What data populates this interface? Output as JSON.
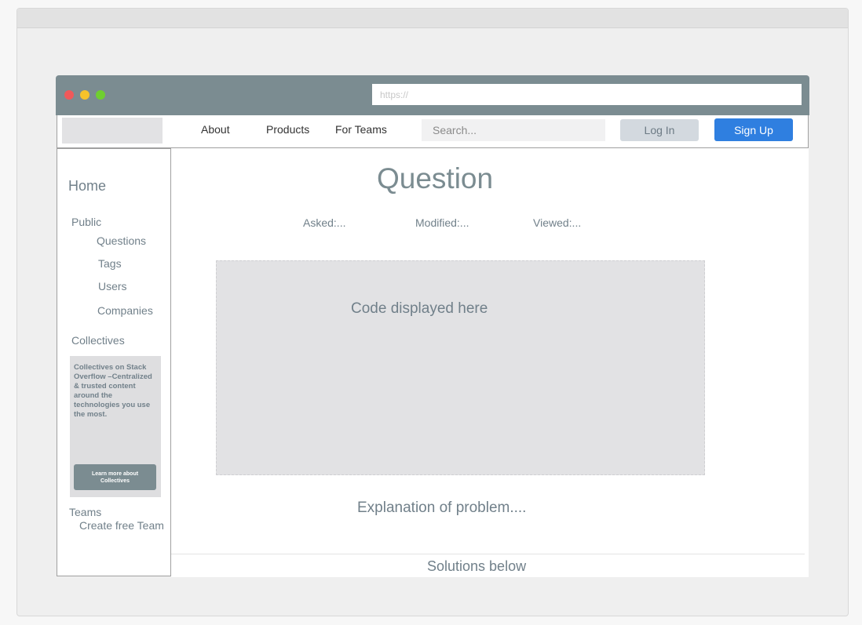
{
  "browser": {
    "url_placeholder": "https://"
  },
  "nav": {
    "links": [
      "About",
      "Products",
      "For Teams"
    ],
    "search_placeholder": "Search...",
    "login_label": "Log In",
    "signup_label": "Sign Up"
  },
  "sidebar": {
    "home": "Home",
    "public": "Public",
    "items": [
      "Questions",
      "Tags",
      "Users",
      "Companies"
    ],
    "collectives": "Collectives",
    "promo_text": "Collectives on Stack Overflow –Centralized & trusted content around the technologies you use the most.",
    "promo_button": "Learn more about Collectives",
    "teams": "Teams",
    "create_team": "Create free Team"
  },
  "question": {
    "title": "Question",
    "asked": "Asked:...",
    "modified": "Modified:...",
    "viewed": "Viewed:...",
    "code_placeholder": "Code displayed here",
    "explanation": "Explanation of problem....",
    "solutions": "Solutions below"
  },
  "colors": {
    "accent": "#2f7fe0",
    "chrome": "#7b8c91",
    "text_muted": "#71808a"
  }
}
